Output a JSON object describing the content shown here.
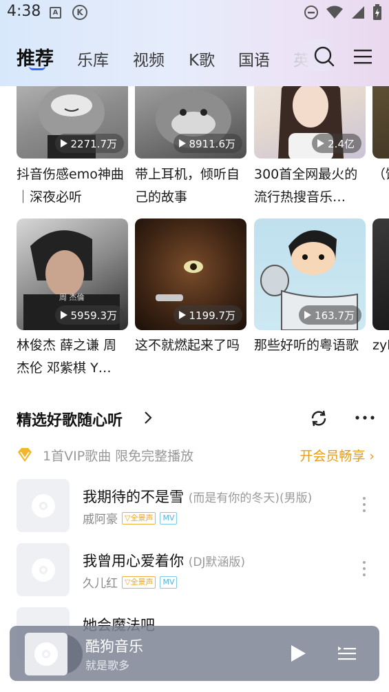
{
  "status_bar": {
    "time": "4:38",
    "icon_a": "A",
    "icon_k": "K"
  },
  "tabs": [
    {
      "label": "推荐",
      "active": true
    },
    {
      "label": "乐库"
    },
    {
      "label": "视频"
    },
    {
      "label": "K歌"
    },
    {
      "label": "国语"
    },
    {
      "label": "英"
    }
  ],
  "playlists": [
    {
      "count": "2271.7万",
      "title": "抖音伤感emo神曲｜深夜必听"
    },
    {
      "count": "8911.6万",
      "title": "带上耳机，倾听自己的故事"
    },
    {
      "count": "2.4亿",
      "title": "300首全网最火的流行热搜音乐…"
    },
    {
      "count": "",
      "title": "（饭爆款"
    },
    {
      "count": "5959.3万",
      "title": "林俊杰 薛之谦 周杰伦 邓紫棋 Y…"
    },
    {
      "count": "1199.7万",
      "title": "这不就燃起来了吗"
    },
    {
      "count": "163.7万",
      "title": "那些好听的粤语歌"
    },
    {
      "count": "",
      "title": "zyb柯呗"
    }
  ],
  "section": {
    "title": "精选好歌随心听"
  },
  "vip_banner": {
    "text": "1首VIP歌曲 限免完整播放",
    "cta": "开会员畅享 ›"
  },
  "songs": [
    {
      "name": "我期待的不是雪",
      "sub": "(而是有你的冬天)(男版)",
      "artist": "戚阿豪",
      "badge_quan": "全景声",
      "badge_mv": "MV"
    },
    {
      "name": "我曾用心爱着你",
      "sub": "(DJ默涵版)",
      "artist": "久儿红",
      "badge_quan": "全景声",
      "badge_mv": "MV"
    },
    {
      "name": "她会魔法吧",
      "sub": "",
      "artist": "",
      "badge_quan": "",
      "badge_mv": ""
    }
  ],
  "player": {
    "title": "酷狗音乐",
    "subtitle": "就是歌多"
  },
  "colors": {
    "accent_blue": "#2f6bff",
    "vip_orange": "#e89b16",
    "badge_blue": "#4fb5dd"
  }
}
